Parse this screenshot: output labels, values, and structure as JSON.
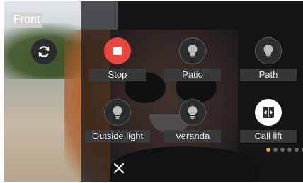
{
  "camera": {
    "label": "Front"
  },
  "actions": [
    {
      "label": "Stop",
      "icon": "stop-icon",
      "color": "#e8463f"
    },
    {
      "label": "Patio",
      "icon": "bulb-icon"
    },
    {
      "label": "Path",
      "icon": "bulb-icon"
    },
    {
      "label": "Outside light",
      "icon": "bulb-icon"
    },
    {
      "label": "Veranda",
      "icon": "bulb-icon"
    },
    {
      "label": "Call lift",
      "icon": "lift-icon"
    }
  ],
  "pager": {
    "pages": 6,
    "current": 1,
    "active_color": "#f0a33a"
  },
  "icons": {
    "refresh": "refresh-icon",
    "close": "close-icon"
  }
}
